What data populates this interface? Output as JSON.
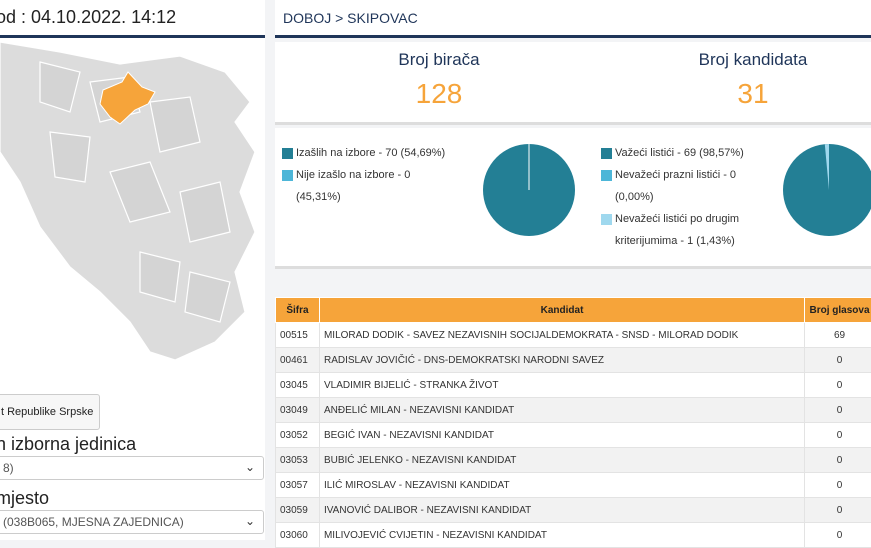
{
  "left": {
    "header": "od : 04.10.2022. 14:12",
    "rs_button": "t Republike Srpske",
    "unit_label": "n izborna jedinica",
    "unit_value": "8)",
    "place_label": "mjesto",
    "place_value": "(038B065, MJESNA ZAJEDNICA)"
  },
  "right": {
    "breadcrumb": "DOBOJ > SKIPOVAC",
    "voters_title": "Broj birača",
    "voters_value": "128",
    "candidates_title": "Broj kandidata",
    "candidates_value": "31"
  },
  "turnout": {
    "voted_label": "Izašlih na izbore - 70 (54,69%)",
    "not_voted_label": "Nije izašlo na izbore - 0",
    "not_voted_pct": "(45,31%)",
    "voted_value": 70,
    "not_voted_value": 0
  },
  "ballots": {
    "valid_label": "Važeći listići - 69 (98,57%)",
    "empty_label": "Nevažeći prazni listići - 0",
    "empty_pct": "(0,00%)",
    "other_label_1": "Nevažeći listići po drugim",
    "other_label_2": "kriterijumima - 1 (1,43%)",
    "valid_value": 69,
    "empty_value": 0,
    "other_value": 1
  },
  "colors": {
    "teal": "#237f95",
    "light_blue": "#4db6d8",
    "pale_blue": "#9fd8ee",
    "orange": "#f6a43a",
    "navy": "#1f3559"
  },
  "table": {
    "headers": [
      "Šifra",
      "Kandidat",
      "Broj glasova"
    ],
    "rows": [
      [
        "00515",
        "MILORAD DODIK - SAVEZ NEZAVISNIH SOCIJALDEMOKRATA - SNSD - MILORAD DODIK",
        "69"
      ],
      [
        "00461",
        "RADISLAV JOVIČIĆ - DNS-DEMOKRATSKI NARODNI SAVEZ",
        "0"
      ],
      [
        "03045",
        "VLADIMIR BIJELIĆ - STRANKA ŽIVOT",
        "0"
      ],
      [
        "03049",
        "ANĐELIĆ MILAN - NEZAVISNI KANDIDAT",
        "0"
      ],
      [
        "03052",
        "BEGIĆ IVAN - NEZAVISNI KANDIDAT",
        "0"
      ],
      [
        "03053",
        "BUBIĆ JELENKO - NEZAVISNI KANDIDAT",
        "0"
      ],
      [
        "03057",
        "ILIĆ MIROSLAV - NEZAVISNI KANDIDAT",
        "0"
      ],
      [
        "03059",
        "IVANOVIĆ DALIBOR - NEZAVISNI KANDIDAT",
        "0"
      ],
      [
        "03060",
        "MILIVOJEVIĆ CVIJETIN - NEZAVISNI KANDIDAT",
        "0"
      ]
    ]
  }
}
